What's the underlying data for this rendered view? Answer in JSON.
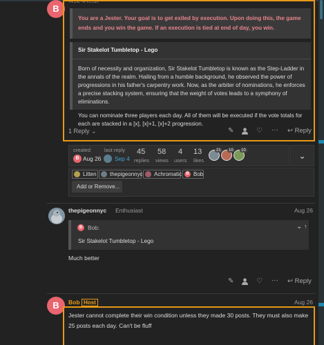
{
  "post1": {
    "author_partial": "Bob (Host)",
    "avatar_letter": "B",
    "goal_text": "You are a Jester. Your goal is to get exiled by execution. Upon doing this, the game ends and you win the game. If an execution is tied at end of day, you win.",
    "card": {
      "title": "Sir Stakelot Tumbletop - Lego",
      "para1": "Born of necessity and organization, Sir Stakelot Tumbletop is known as the Step-Ladder in the annals of the realm. Hailing from a humble background, he observed the power of progressions in his father's carpentry work. Now, as the arbiter of nominations, he enforces a precise stacking system, ensuring that the weight of votes leads to a symphony of eliminations.",
      "para2": "You can nominate three players each day. All of them will be executed if the vote totals for each are stacked in a [x], [x]+1, [x]+2 progression."
    },
    "replies_toggle": "1 Reply",
    "reply_label": "Reply"
  },
  "topic_map": {
    "created_label": "created",
    "created_date": "Aug 26",
    "created_avatar": "B",
    "last_reply_label": "last reply",
    "last_reply_date": "Sep 4",
    "stats": [
      {
        "num": "45",
        "label": "replies"
      },
      {
        "num": "58",
        "label": "views"
      },
      {
        "num": "4",
        "label": "users"
      },
      {
        "num": "13",
        "label": "likes"
      }
    ],
    "participant_counts": [
      "21",
      "10",
      "10"
    ]
  },
  "invitees": {
    "chips": [
      "Litten",
      "thepigeonnyc",
      "Achromatic",
      "Bob"
    ],
    "bob_letter": "B",
    "add_label": "Add or Remove..."
  },
  "post2": {
    "author": "thepigeonnyc",
    "title": "Enthusiast",
    "date": "Aug 26",
    "quote_author": "Bob:",
    "quote_letter": "B",
    "quote_body": "Sir Stakelot Tumbletop - Lego",
    "body": "Much better",
    "reply_label": "Reply"
  },
  "post3": {
    "author": "Bob",
    "avatar_letter": "B",
    "badge": "Host",
    "date": "Aug 26",
    "body": "Jester cannot complete their win condition unless they made 30 posts. They must also make 25 posts each day. Can't be fluff"
  },
  "colors": {
    "accent": "#e89a16",
    "avatar_red": "#e9656f",
    "link_blue": "#3fa7d6",
    "goal_text": "#e8848c"
  }
}
